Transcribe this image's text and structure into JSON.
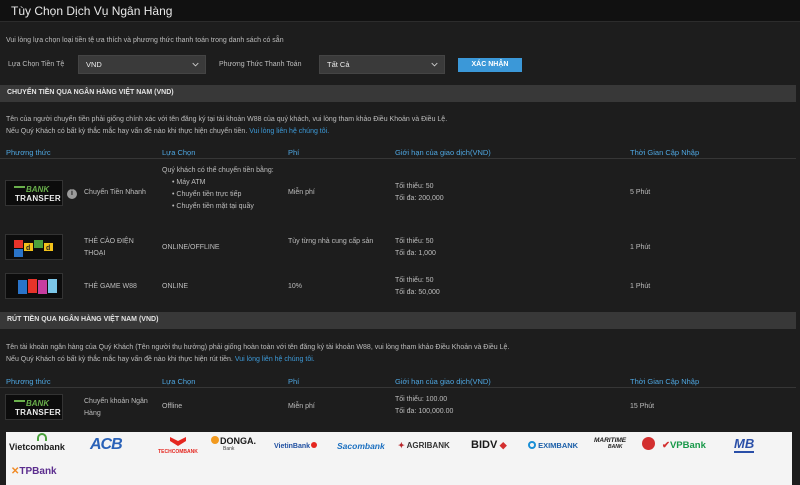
{
  "title": "Tùy Chọn Dịch Vụ Ngân Hàng",
  "intro": "Vui lòng lựa chọn loại tiền tệ ưa thích và phương thức thanh toán trong danh sách có sẵn",
  "filters": {
    "currency_label": "Lựa Chọn Tiền Tệ",
    "currency_value": "VND",
    "method_label": "Phương Thức Thanh Toán",
    "method_value": "Tất Cả",
    "confirm_label": "XÁC NHẬN"
  },
  "deposit": {
    "heading": "CHUYỂN TIỀN QUA NGÂN HÀNG VIỆT NAM (VND)",
    "note1": "Tên của người chuyển tiền phải giống chính xác với tên đăng ký tại tài khoản W88 của quý khách, vui lòng tham khảo Điều Khoản và Điều Lệ.",
    "note2": "Nếu Quý Khách có bất kỳ thắc mắc hay vấn đề nào khi thực hiện chuyển tiền.",
    "note2_link": "Vui lòng liên hệ chúng tôi.",
    "columns": [
      "Phương thức",
      "Lựa Chọn",
      "Phí",
      "Giới hạn của giao dịch(VND)",
      "Thời Gian Cập Nhập"
    ],
    "rows": [
      {
        "method": "Chuyển Tiền Nhanh",
        "option_title": "Quý khách có thể chuyển tiền bằng:",
        "options": [
          "Máy ATM",
          "Chuyển tiền trực tiếp",
          "Chuyển tiền mặt tại quầy"
        ],
        "fee": "Miễn phí",
        "min": "Tối thiểu: 50",
        "max": "Tối đa: 200,000",
        "time": "5 Phút"
      },
      {
        "method_line1": "THẺ CÀO ĐIỆN",
        "method_line2": "THOẠI",
        "option": "ONLINE/OFFLINE",
        "fee": "Tùy từng nhà cung cấp sản",
        "min": "Tối thiểu: 50",
        "max": "Tối đa: 1,000",
        "time": "1 Phút"
      },
      {
        "method": "THẺ GAME W88",
        "option": "ONLINE",
        "fee": "10%",
        "min": "Tối thiểu: 50",
        "max": "Tối đa: 50,000",
        "time": "1 Phút"
      }
    ]
  },
  "withdraw": {
    "heading": "RÚT TIỀN QUA NGÂN HÀNG VIỆT NAM (VND)",
    "note1": "Tên tài khoản ngân hàng của Quý Khách (Tên người thụ hưởng) phải giống hoàn toàn với tên đăng ký tài khoản W88, vui lòng tham khảo Điều Khoản và Điều Lệ.",
    "note2": "Nếu Quý Khách có bất kỳ thắc mắc hay vấn đề nào khi thực hiện rút tiền.",
    "note2_link": "Vui lòng liên hệ chúng tôi.",
    "columns": [
      "Phương thức",
      "Lựa Chọn",
      "Phí",
      "Giới hạn của giao dịch(VND)",
      "Thời Gian Cập Nhập"
    ],
    "row": {
      "method_line1": "Chuyển khoản Ngân",
      "method_line2": "Hàng",
      "option": "Offline",
      "fee": "Miễn phí",
      "min": "Tối thiểu: 100.00",
      "max": "Tối đa: 100,000.00",
      "time": "15 Phút"
    }
  },
  "bank_transfer_logo": {
    "line1": "BANK",
    "line2": "TRANSFER"
  },
  "banks": {
    "vietcombank": "Vietcombank",
    "acb": "ACB",
    "techcombank": "TECHCOMBANK",
    "donga": "DONGA.",
    "donga_sub": "Bank",
    "vietinbank": "VietinBank",
    "sacombank": "Sacombank",
    "agribank": "AGRIBANK",
    "bidv": "BIDV",
    "eximbank": "EXIMBANK",
    "maritime": "MARITIME",
    "maritime_sub": "BANK",
    "vpbank": "VPBank",
    "mb": "MB",
    "tpbank": "TPBank"
  },
  "colors": {
    "accent": "#3b98d8",
    "header_text": "#4ea6e0",
    "section_bar": "#383838",
    "background": "#1d1d1d"
  }
}
